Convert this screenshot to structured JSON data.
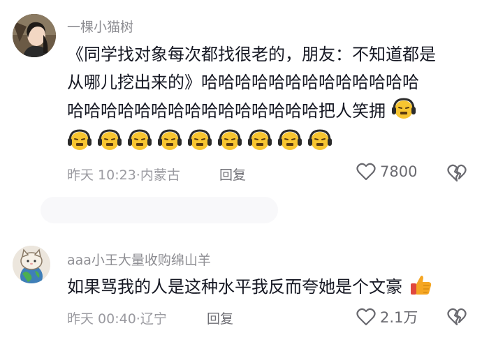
{
  "comments": [
    {
      "username": "一棵小猫树",
      "text_line1": "《同学找对象每次都找很老的，朋友：不知道都是",
      "text_line2": "从哪儿挖出来的》哈哈哈哈哈哈哈哈哈哈哈哈哈",
      "text_line3": "哈哈哈哈哈哈哈哈哈哈哈哈哈哈哈把人笑拥",
      "trailing_emoji_name": "grimacing-headphones-emoji",
      "extra_emoji_count": 9,
      "time": "昨天 10:23",
      "location": "内蒙古",
      "separator": "·",
      "reply_label": "回复",
      "like_count": "7800"
    },
    {
      "username": "aaa小王大量收购绵山羊",
      "text": "如果骂我的人是这种水平我反而夸她是个文豪",
      "trailing_emoji_name": "thumbs-up-emoji",
      "time": "昨天 00:40",
      "location": "辽宁",
      "separator": "·",
      "reply_label": "回复",
      "like_count": "2.1万"
    }
  ],
  "colors": {
    "username": "#8e8e93",
    "text": "#161823",
    "meta": "#9a9aa0",
    "emoji_face": "#f7c531",
    "headphones": "#2b2b2b",
    "thumb": "#f5a623"
  }
}
